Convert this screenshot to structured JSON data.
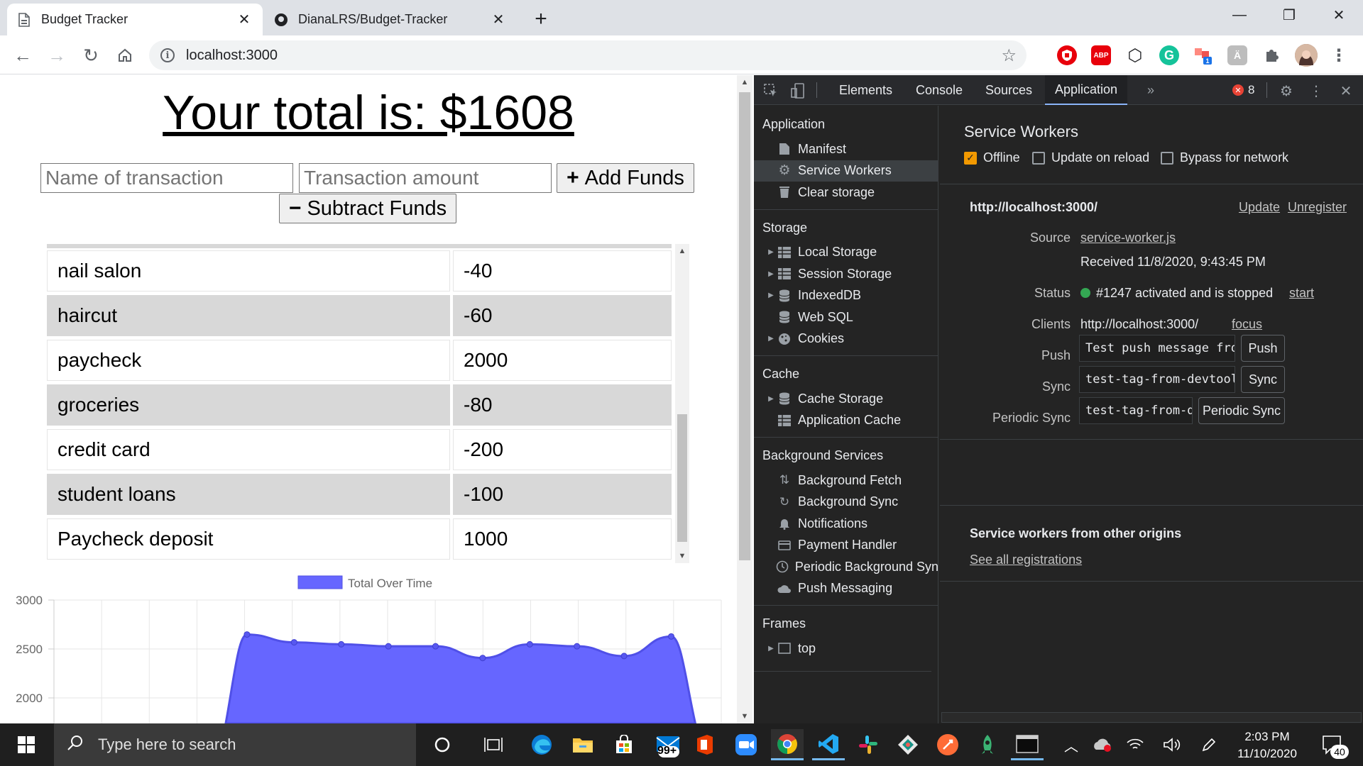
{
  "browser": {
    "tabs": [
      {
        "title": "Budget Tracker",
        "active": true
      },
      {
        "title": "DianaLRS/Budget-Tracker",
        "active": false
      }
    ],
    "new_tab_label": "+",
    "url": "localhost:3000",
    "extensions": [
      {
        "name": "ublock-icon",
        "label": "",
        "color": "#e8000b"
      },
      {
        "name": "abp-icon",
        "label": "ABP",
        "color": "#e8000b"
      },
      {
        "name": "cube-icon",
        "label": "⬡",
        "color": "#5f6368"
      },
      {
        "name": "grammarly-icon",
        "label": "G",
        "color": "#15c39a"
      },
      {
        "name": "badge-ext-icon",
        "label": "1",
        "color": "#ff5252"
      },
      {
        "name": "ext-a-icon",
        "label": "Ä",
        "color": "#9e9e9e"
      },
      {
        "name": "puzzle-icon",
        "label": "✱",
        "color": "#5f6368"
      }
    ]
  },
  "app": {
    "total_text": "Your total is: $1608",
    "name_placeholder": "Name of transaction",
    "amount_placeholder": "Transaction amount",
    "add_label": "Add Funds",
    "add_icon": "+",
    "subtract_label": "Subtract Funds",
    "subtract_icon": "−",
    "transactions": [
      {
        "name": "nail salon",
        "value": "-40"
      },
      {
        "name": "haircut",
        "value": "-60"
      },
      {
        "name": "paycheck",
        "value": "2000"
      },
      {
        "name": "groceries",
        "value": "-80"
      },
      {
        "name": "credit card",
        "value": "-200"
      },
      {
        "name": "student loans",
        "value": "-100"
      },
      {
        "name": "Paycheck deposit",
        "value": "1000"
      }
    ]
  },
  "chart_data": {
    "type": "area",
    "series": [
      {
        "name": "Total Over Time",
        "color": "#6666ff"
      }
    ],
    "y_ticks": [
      "3000",
      "2500",
      "2000"
    ],
    "ylim": [
      1850,
      3000
    ],
    "values": [
      2648,
      2568,
      2548,
      2528,
      2528,
      2408,
      2548,
      2528,
      2428,
      2628
    ],
    "grid": true
  },
  "devtools": {
    "tabs": [
      "Elements",
      "Console",
      "Sources",
      "Application"
    ],
    "selected_tab": "Application",
    "more_tabs": "»",
    "error_count": "8",
    "sidebar": {
      "application_title": "Application",
      "application_items": [
        {
          "label": "Manifest",
          "icon": "manifest-icon",
          "selected": false
        },
        {
          "label": "Service Workers",
          "icon": "gear-icon",
          "selected": true
        },
        {
          "label": "Clear storage",
          "icon": "trash-icon",
          "selected": false
        }
      ],
      "storage_title": "Storage",
      "storage_items": [
        {
          "label": "Local Storage",
          "icon": "grid-icon",
          "expandable": true
        },
        {
          "label": "Session Storage",
          "icon": "grid-icon",
          "expandable": true
        },
        {
          "label": "IndexedDB",
          "icon": "database-icon",
          "expandable": true
        },
        {
          "label": "Web SQL",
          "icon": "database-icon",
          "expandable": false
        },
        {
          "label": "Cookies",
          "icon": "cookie-icon",
          "expandable": true
        }
      ],
      "cache_title": "Cache",
      "cache_items": [
        {
          "label": "Cache Storage",
          "icon": "database-icon",
          "expandable": true
        },
        {
          "label": "Application Cache",
          "icon": "grid-icon",
          "expandable": false
        }
      ],
      "bg_title": "Background Services",
      "bg_items": [
        {
          "label": "Background Fetch",
          "icon": "updown-arrows-icon"
        },
        {
          "label": "Background Sync",
          "icon": "sync-icon"
        },
        {
          "label": "Notifications",
          "icon": "bell-icon"
        },
        {
          "label": "Payment Handler",
          "icon": "card-icon"
        },
        {
          "label": "Periodic Background Syn",
          "icon": "clock-icon"
        },
        {
          "label": "Push Messaging",
          "icon": "cloud-icon"
        }
      ],
      "frames_title": "Frames",
      "frames_items": [
        {
          "label": "top",
          "icon": "frame-icon",
          "expandable": true
        }
      ]
    },
    "service_workers": {
      "title": "Service Workers",
      "offline_label": "Offline",
      "offline_checked": true,
      "update_on_reload_label": "Update on reload",
      "update_on_reload_checked": false,
      "bypass_label": "Bypass for network",
      "bypass_checked": false,
      "origin": "http://localhost:3000/",
      "update_link": "Update",
      "unregister_link": "Unregister",
      "source_label": "Source",
      "source_link": "service-worker.js",
      "received": "Received 11/8/2020, 9:43:45 PM",
      "status_label": "Status",
      "status_text": "#1247 activated and is stopped",
      "status_color": "#34a853",
      "start_link": "start",
      "clients_label": "Clients",
      "clients_value": "http://localhost:3000/",
      "focus_link": "focus",
      "push_label": "Push",
      "push_value": "Test push message from DevTools.",
      "push_button": "Push",
      "sync_label": "Sync",
      "sync_value": "test-tag-from-devtools",
      "sync_button": "Sync",
      "periodic_label": "Periodic Sync",
      "periodic_value": "test-tag-from-devtools",
      "periodic_button": "Periodic Sync",
      "other_origins_title": "Service workers from other origins",
      "see_all_link": "See all registrations"
    }
  },
  "taskbar": {
    "search_placeholder": "Type here to search",
    "mail_badge": "99+",
    "time": "2:03 PM",
    "date": "11/10/2020",
    "notification_count": "40"
  }
}
